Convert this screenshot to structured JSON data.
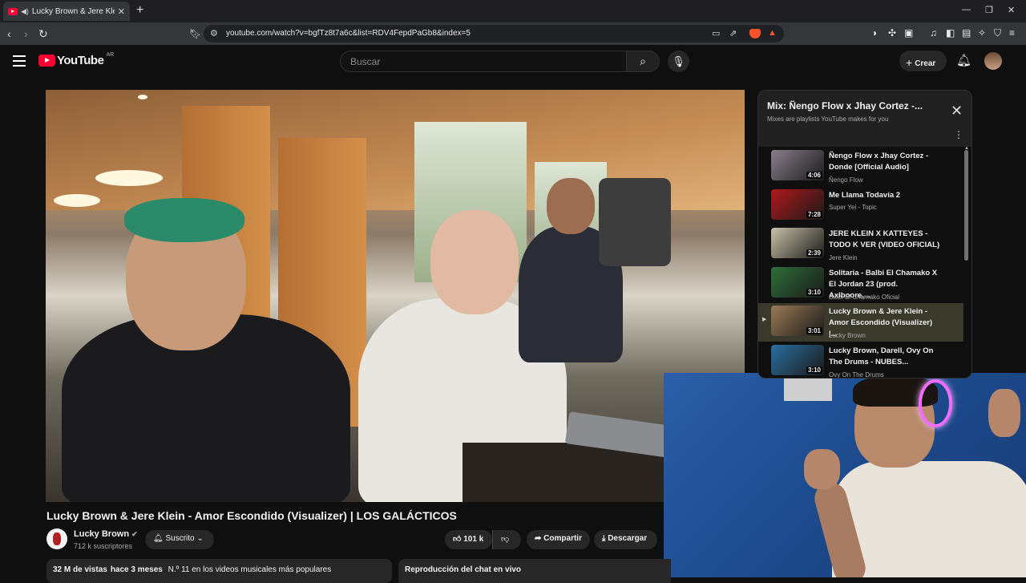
{
  "browser": {
    "tab_title": "Lucky Brown & Jere Klein - Ar",
    "url": "youtube.com/watch?v=bgfTz8t7a6c&list=RDV4FepdPaGb8&index=5"
  },
  "header": {
    "logo_text": "YouTube",
    "country": "AR",
    "search_placeholder": "Buscar",
    "create_label": "Crear"
  },
  "video": {
    "title": "Lucky Brown & Jere Klein - Amor Escondido (Visualizer) | LOS GALÁCTICOS",
    "channel": "Lucky Brown",
    "subscribers": "712 k suscriptores",
    "subscribe_label": "Suscrito",
    "likes": "101 k",
    "share_label": "Compartir",
    "download_label": "Descargar",
    "views": "32 M de vistas",
    "age": "hace 3 meses",
    "rank": "N.º 11 en los videos musicales más populares",
    "chat_replay": "Reproducción del chat en vivo"
  },
  "playlist": {
    "title": "Mix: Ñengo Flow x Jhay Cortez -...",
    "subtitle": "Mixes are playlists YouTube makes for you",
    "items": [
      {
        "title": "Ñengo Flow x Jhay Cortez - Donde [Official Audio]",
        "channel": "Ñengo Flow",
        "duration": "4:06",
        "thumb": "#8a7f8c"
      },
      {
        "title": "Me Llama Todavía 2",
        "channel": "Super Yei - Topic",
        "duration": "7:28",
        "thumb": "#b0181c"
      },
      {
        "title": "JERE KLEIN X KATTEYES - TODO K VER (VIDEO OFICIAL)",
        "channel": "Jere Klein",
        "duration": "2:39",
        "thumb": "#c9c2a8"
      },
      {
        "title": "Solitaria - Balbi El Chamako X El Jordan 23 (prod. Axlboore,...",
        "channel": "Balbi El Chamako Oficial",
        "duration": "3:10",
        "thumb": "#2f6e3a"
      },
      {
        "title": "Lucky Brown & Jere Klein - Amor Escondido (Visualizer) |...",
        "channel": "Lucky Brown",
        "duration": "3:01",
        "thumb": "#9a7a56"
      },
      {
        "title": "Lucky Brown, Darell, Ovy On The Drums - NUBES...",
        "channel": "Ovy On The Drums",
        "duration": "3:10",
        "thumb": "#2a6fa0"
      }
    ]
  }
}
